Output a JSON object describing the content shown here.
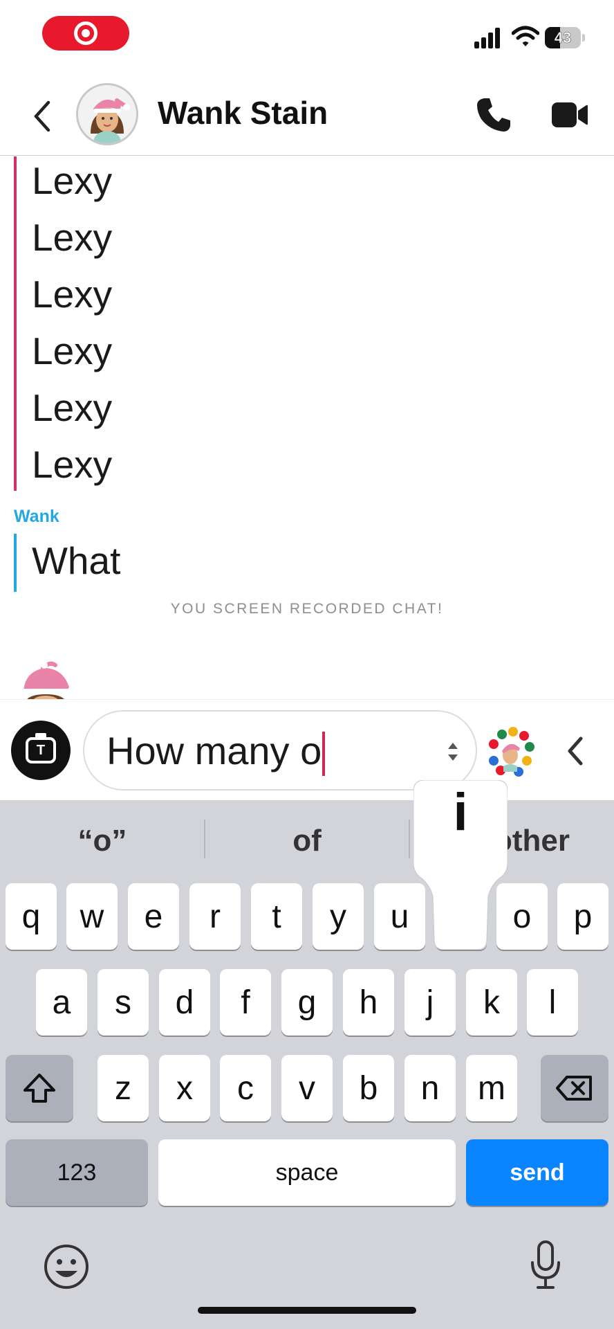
{
  "status_bar": {
    "recording_indicator": "screen-recording-target-icon",
    "battery_level": "43",
    "battery_fraction": 0.43,
    "icons": [
      "cellular-signal-icon",
      "wifi-icon",
      "battery-icon"
    ]
  },
  "header": {
    "contact_name": "Wank Stain",
    "back_icon": "chevron-left-icon",
    "call_icon": "phone-icon",
    "video_icon": "video-camera-icon"
  },
  "chat": {
    "lexy_messages": [
      "Lexy",
      "Lexy",
      "Lexy",
      "Lexy",
      "Lexy",
      "Lexy"
    ],
    "lexy_color": "#d62d6b",
    "wank_sender": "Wank",
    "wank_color": "#23a9e1",
    "wank_message": "What",
    "system_note": "YOU SCREEN RECORDED CHAT!"
  },
  "composer": {
    "camera_letter": "T",
    "text_value": "How many o",
    "caret_color": "#d1284f"
  },
  "keyboard": {
    "suggestions": [
      "“o”",
      "of",
      "other"
    ],
    "popup_key": "i",
    "row1": [
      "q",
      "w",
      "e",
      "r",
      "t",
      "y",
      "u",
      "i",
      "o",
      "p"
    ],
    "row2": [
      "a",
      "s",
      "d",
      "f",
      "g",
      "h",
      "j",
      "k",
      "l"
    ],
    "row3": [
      "z",
      "x",
      "c",
      "v",
      "b",
      "n",
      "m"
    ],
    "numbers_label": "123",
    "space_label": "space",
    "send_label": "send",
    "send_color": "#0a84ff"
  }
}
